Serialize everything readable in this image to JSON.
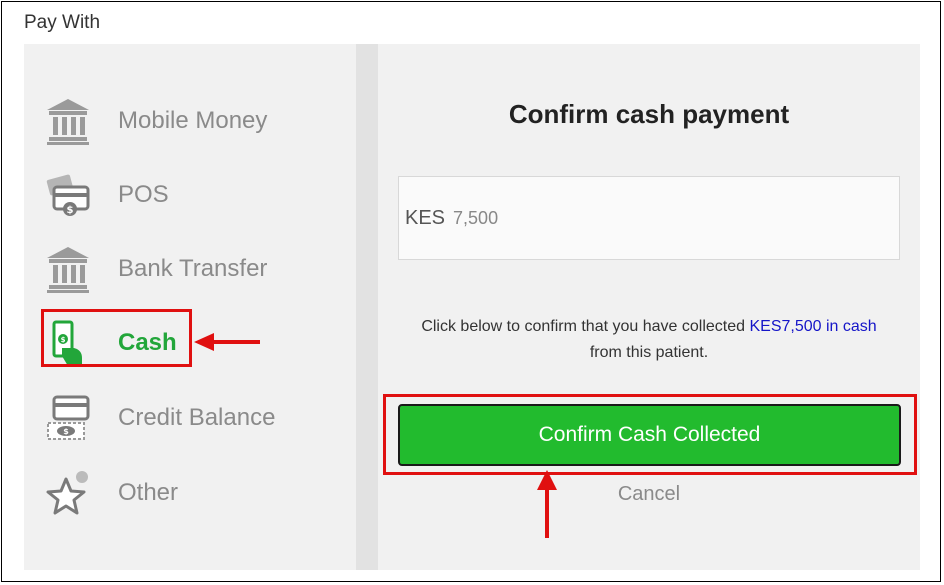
{
  "dialog": {
    "title": "Pay With"
  },
  "payment_methods": [
    {
      "label": "Mobile Money",
      "icon": "bank-icon",
      "active": false
    },
    {
      "label": "POS",
      "icon": "pos-card-icon",
      "active": false
    },
    {
      "label": "Bank Transfer",
      "icon": "bank-icon",
      "active": false
    },
    {
      "label": "Cash",
      "icon": "cash-hand-icon",
      "active": true
    },
    {
      "label": "Credit Balance",
      "icon": "credit-balance-icon",
      "active": false
    },
    {
      "label": "Other",
      "icon": "star-icon",
      "active": false
    }
  ],
  "confirm": {
    "title": "Confirm cash payment",
    "currency": "KES",
    "amount": "7,500",
    "message_prefix": "Click below to confirm that you have collected ",
    "message_highlight": "KES7,500 in cash",
    "message_suffix": "from this patient.",
    "button_label": "Confirm Cash Collected",
    "cancel_label": "Cancel"
  },
  "colors": {
    "accent_green": "#22bb2e",
    "active_label": "#22a63a",
    "highlight_blue": "#1515c8",
    "annotation_red": "#e01010"
  }
}
